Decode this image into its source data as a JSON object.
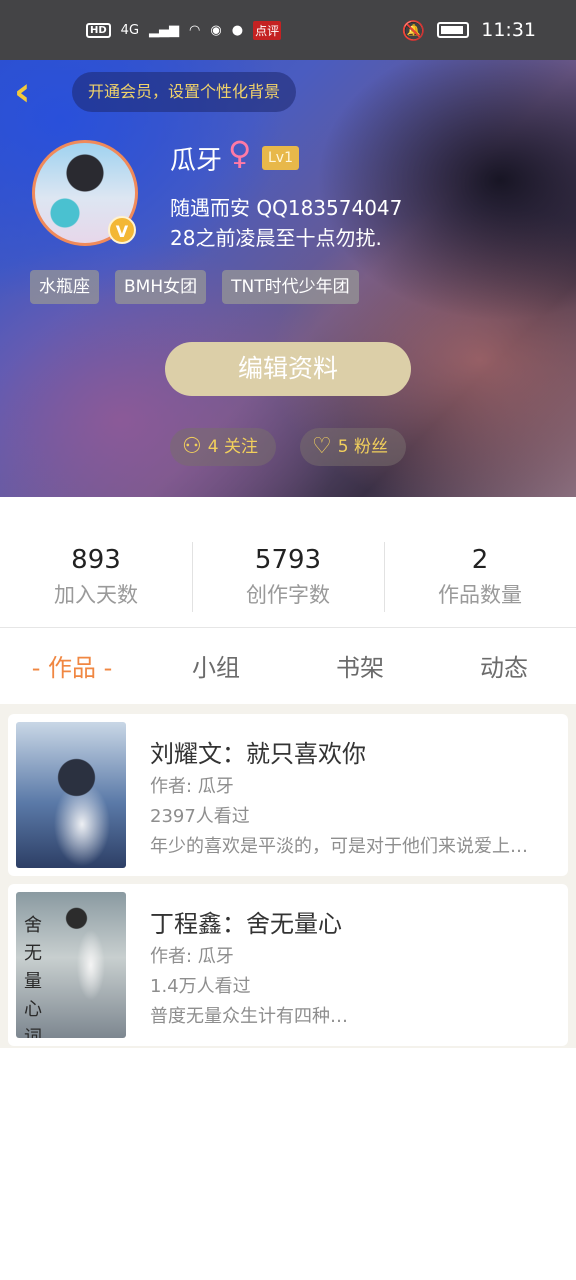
{
  "status_bar": {
    "left_badges": [
      "HD",
      "4G"
    ],
    "app_badge": "点评",
    "time": "11:31"
  },
  "header": {
    "vip_prompt": "开通会员，设置个性化背景",
    "username": "瓜牙",
    "gender_symbol": "♀",
    "level": "Lv1",
    "verified_mark": "V",
    "bio_line1": "随遇而安 QQ183574047",
    "bio_line2": "28之前凌晨至十点勿扰.",
    "tags": [
      "水瓶座",
      "BMH女团",
      "TNT时代少年团"
    ],
    "edit_button": "编辑资料",
    "follow_label": "4 关注",
    "fans_label": "5 粉丝",
    "accent_color": "#f3c93c"
  },
  "stats": [
    {
      "value": "893",
      "label": "加入天数"
    },
    {
      "value": "5793",
      "label": "创作字数"
    },
    {
      "value": "2",
      "label": "作品数量"
    }
  ],
  "tabs": [
    {
      "label": "- 作品 -",
      "active": true
    },
    {
      "label": "小组",
      "active": false
    },
    {
      "label": "书架",
      "active": false
    },
    {
      "label": "动态",
      "active": false
    }
  ],
  "works": [
    {
      "title": "刘耀文：就只喜欢你",
      "author": "作者: 瓜牙",
      "views": "2397人看过",
      "description": "年少的喜欢是平淡的，可是对于他们来说爱上…"
    },
    {
      "title": "丁程鑫：舍无量心",
      "author": "作者: 瓜牙",
      "views": "1.4万人看过",
      "description": "普度无量众生计有四种…",
      "cover_text": "舍无量心词"
    }
  ]
}
